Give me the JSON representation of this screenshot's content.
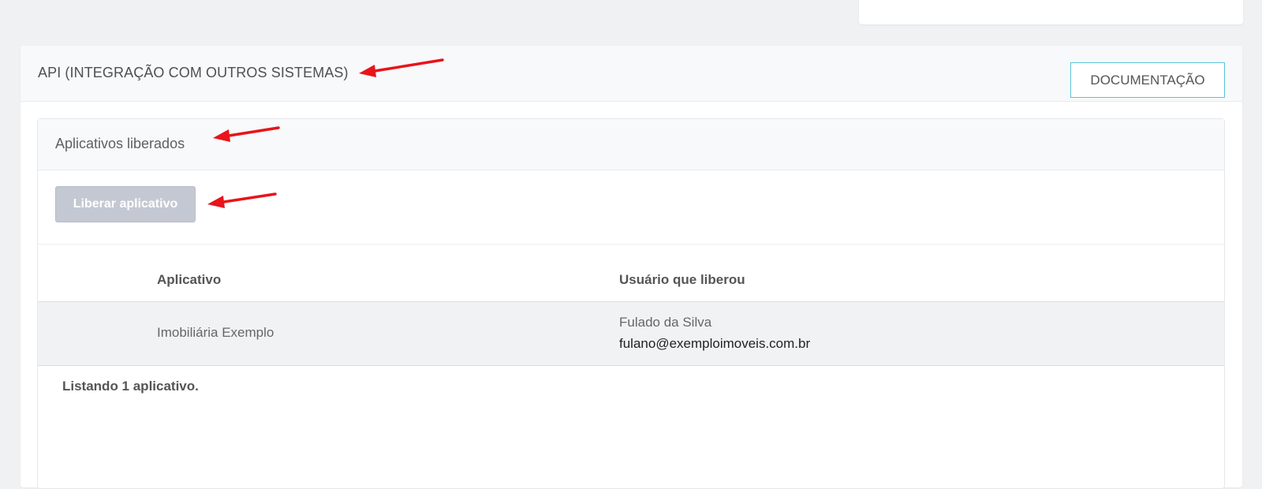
{
  "api_section": {
    "title": "API (INTEGRAÇÃO COM OUTROS SISTEMAS)",
    "documentation_button": "DOCUMENTAÇÃO"
  },
  "apps_panel": {
    "title": "Aplicativos liberados",
    "release_button": "Liberar aplicativo"
  },
  "table": {
    "columns": [
      "Aplicativo",
      "Usuário que liberou"
    ],
    "rows": [
      {
        "app": "Imobiliária Exemplo",
        "user_name": "Fulado da Silva",
        "user_email": "fulano@exemploimoveis.com.br"
      }
    ],
    "footer": "Listando 1 aplicativo."
  },
  "annotations": {
    "arrow_color": "#e8141a",
    "arrow_icon": "red-arrow-icon"
  },
  "colors": {
    "page_background": "#f0f1f3",
    "documentation_border": "#5bc0de",
    "release_button_bg": "#c4c8d3",
    "row_highlight": "#f1f2f4"
  }
}
